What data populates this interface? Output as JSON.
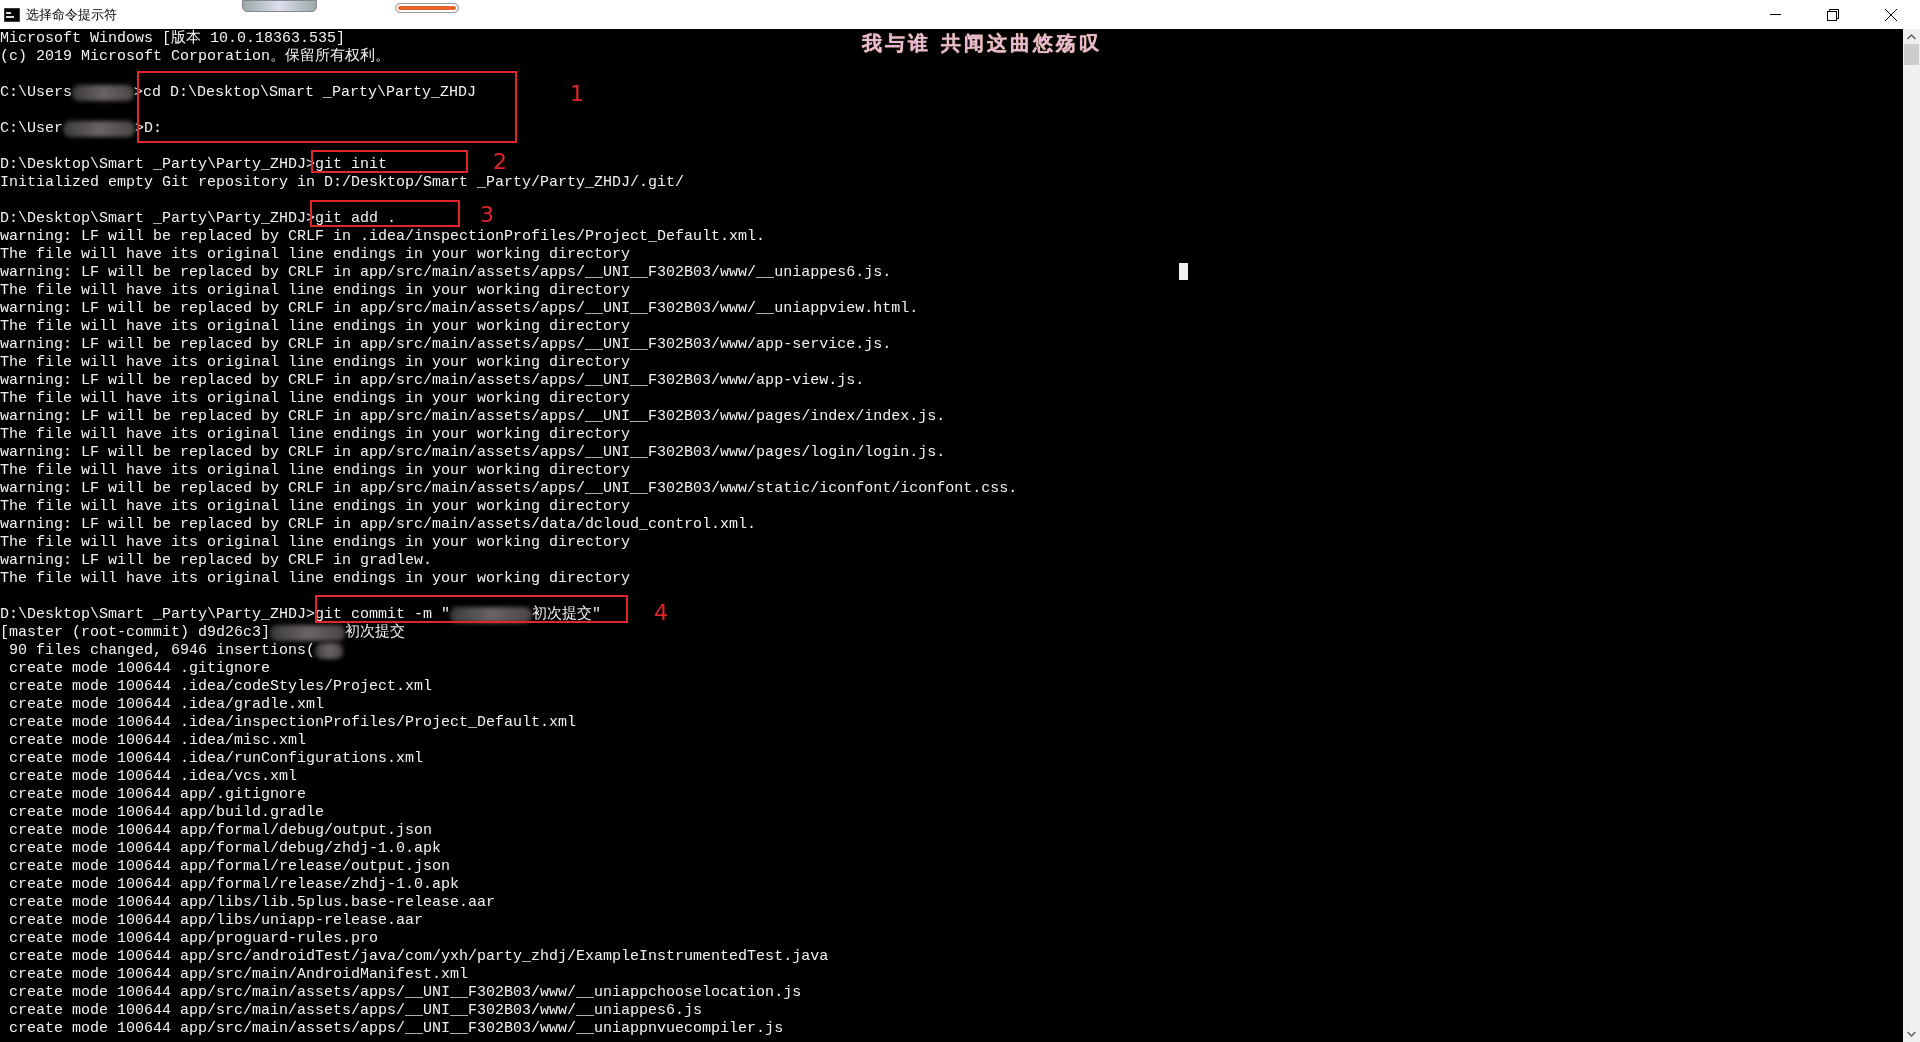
{
  "window": {
    "title": "选择命令提示符"
  },
  "overlay_caption": "我与谁 共闻这曲悠殇叹",
  "lines": [
    {
      "kind": "text",
      "text": "Microsoft Windows [版本 10.0.18363.535]"
    },
    {
      "kind": "text",
      "text": "(c) 2019 Microsoft Corporation。保留所有权利。"
    },
    {
      "kind": "blank"
    },
    {
      "kind": "parts",
      "parts": [
        {
          "kind": "text",
          "text": "C:\\Users"
        },
        {
          "kind": "redacted"
        },
        {
          "kind": "text",
          "text": ">cd D:\\Desktop\\Smart _Party\\Party_ZHDJ"
        }
      ]
    },
    {
      "kind": "blank"
    },
    {
      "kind": "parts",
      "parts": [
        {
          "kind": "text",
          "text": "C:\\User"
        },
        {
          "kind": "redacted"
        },
        {
          "kind": "text",
          "text": ">D:"
        }
      ]
    },
    {
      "kind": "blank"
    },
    {
      "kind": "text",
      "text": "D:\\Desktop\\Smart _Party\\Party_ZHDJ>git init"
    },
    {
      "kind": "text",
      "text": "Initialized empty Git repository in D:/Desktop/Smart _Party/Party_ZHDJ/.git/"
    },
    {
      "kind": "blank"
    },
    {
      "kind": "text",
      "text": "D:\\Desktop\\Smart _Party\\Party_ZHDJ>git add ."
    },
    {
      "kind": "text",
      "text": "warning: LF will be replaced by CRLF in .idea/inspectionProfiles/Project_Default.xml."
    },
    {
      "kind": "text",
      "text": "The file will have its original line endings in your working directory"
    },
    {
      "kind": "text",
      "text": "warning: LF will be replaced by CRLF in app/src/main/assets/apps/__UNI__F302B03/www/__uniappes6.js."
    },
    {
      "kind": "text",
      "text": "The file will have its original line endings in your working directory"
    },
    {
      "kind": "text",
      "text": "warning: LF will be replaced by CRLF in app/src/main/assets/apps/__UNI__F302B03/www/__uniappview.html."
    },
    {
      "kind": "text",
      "text": "The file will have its original line endings in your working directory"
    },
    {
      "kind": "text",
      "text": "warning: LF will be replaced by CRLF in app/src/main/assets/apps/__UNI__F302B03/www/app-service.js."
    },
    {
      "kind": "text",
      "text": "The file will have its original line endings in your working directory"
    },
    {
      "kind": "text",
      "text": "warning: LF will be replaced by CRLF in app/src/main/assets/apps/__UNI__F302B03/www/app-view.js."
    },
    {
      "kind": "text",
      "text": "The file will have its original line endings in your working directory"
    },
    {
      "kind": "text",
      "text": "warning: LF will be replaced by CRLF in app/src/main/assets/apps/__UNI__F302B03/www/pages/index/index.js."
    },
    {
      "kind": "text",
      "text": "The file will have its original line endings in your working directory"
    },
    {
      "kind": "text",
      "text": "warning: LF will be replaced by CRLF in app/src/main/assets/apps/__UNI__F302B03/www/pages/login/login.js."
    },
    {
      "kind": "text",
      "text": "The file will have its original line endings in your working directory"
    },
    {
      "kind": "text",
      "text": "warning: LF will be replaced by CRLF in app/src/main/assets/apps/__UNI__F302B03/www/static/iconfont/iconfont.css."
    },
    {
      "kind": "text",
      "text": "The file will have its original line endings in your working directory"
    },
    {
      "kind": "text",
      "text": "warning: LF will be replaced by CRLF in app/src/main/assets/data/dcloud_control.xml."
    },
    {
      "kind": "text",
      "text": "The file will have its original line endings in your working directory"
    },
    {
      "kind": "text",
      "text": "warning: LF will be replaced by CRLF in gradlew."
    },
    {
      "kind": "text",
      "text": "The file will have its original line endings in your working directory"
    },
    {
      "kind": "blank"
    },
    {
      "kind": "parts",
      "parts": [
        {
          "kind": "text",
          "text": "D:\\Desktop\\Smart _Party\\Party_ZHDJ>git commit -m \""
        },
        {
          "kind": "redacted"
        },
        {
          "kind": "text",
          "text": "初次提交\""
        }
      ]
    },
    {
      "kind": "parts",
      "parts": [
        {
          "kind": "text",
          "text": "[master (root-commit) d9d26c3]"
        },
        {
          "kind": "redacted"
        },
        {
          "kind": "text",
          "text": "初次提交"
        }
      ]
    },
    {
      "kind": "parts",
      "parts": [
        {
          "kind": "text",
          "text": " 90 files changed, 6946 insertions("
        },
        {
          "kind": "redacted"
        }
      ]
    },
    {
      "kind": "text",
      "text": " create mode 100644 .gitignore"
    },
    {
      "kind": "text",
      "text": " create mode 100644 .idea/codeStyles/Project.xml"
    },
    {
      "kind": "text",
      "text": " create mode 100644 .idea/gradle.xml"
    },
    {
      "kind": "text",
      "text": " create mode 100644 .idea/inspectionProfiles/Project_Default.xml"
    },
    {
      "kind": "text",
      "text": " create mode 100644 .idea/misc.xml"
    },
    {
      "kind": "text",
      "text": " create mode 100644 .idea/runConfigurations.xml"
    },
    {
      "kind": "text",
      "text": " create mode 100644 .idea/vcs.xml"
    },
    {
      "kind": "text",
      "text": " create mode 100644 app/.gitignore"
    },
    {
      "kind": "text",
      "text": " create mode 100644 app/build.gradle"
    },
    {
      "kind": "text",
      "text": " create mode 100644 app/formal/debug/output.json"
    },
    {
      "kind": "text",
      "text": " create mode 100644 app/formal/debug/zhdj-1.0.apk"
    },
    {
      "kind": "text",
      "text": " create mode 100644 app/formal/release/output.json"
    },
    {
      "kind": "text",
      "text": " create mode 100644 app/formal/release/zhdj-1.0.apk"
    },
    {
      "kind": "text",
      "text": " create mode 100644 app/libs/lib.5plus.base-release.aar"
    },
    {
      "kind": "text",
      "text": " create mode 100644 app/libs/uniapp-release.aar"
    },
    {
      "kind": "text",
      "text": " create mode 100644 app/proguard-rules.pro"
    },
    {
      "kind": "text",
      "text": " create mode 100644 app/src/androidTest/java/com/yxh/party_zhdj/ExampleInstrumentedTest.java"
    },
    {
      "kind": "text",
      "text": " create mode 100644 app/src/main/AndroidManifest.xml"
    },
    {
      "kind": "text",
      "text": " create mode 100644 app/src/main/assets/apps/__UNI__F302B03/www/__uniappchooselocation.js"
    },
    {
      "kind": "text",
      "text": " create mode 100644 app/src/main/assets/apps/__UNI__F302B03/www/__uniappes6.js"
    },
    {
      "kind": "text",
      "text": " create mode 100644 app/src/main/assets/apps/__UNI__F302B03/www/__uniappnvuecompiler.js"
    }
  ],
  "annotations": [
    {
      "kind": "box"
    },
    {
      "kind": "number",
      "text": "1"
    },
    {
      "kind": "box"
    },
    {
      "kind": "number",
      "text": "2"
    },
    {
      "kind": "box"
    },
    {
      "kind": "number",
      "text": "3"
    },
    {
      "kind": "box"
    },
    {
      "kind": "number",
      "text": "4"
    }
  ]
}
